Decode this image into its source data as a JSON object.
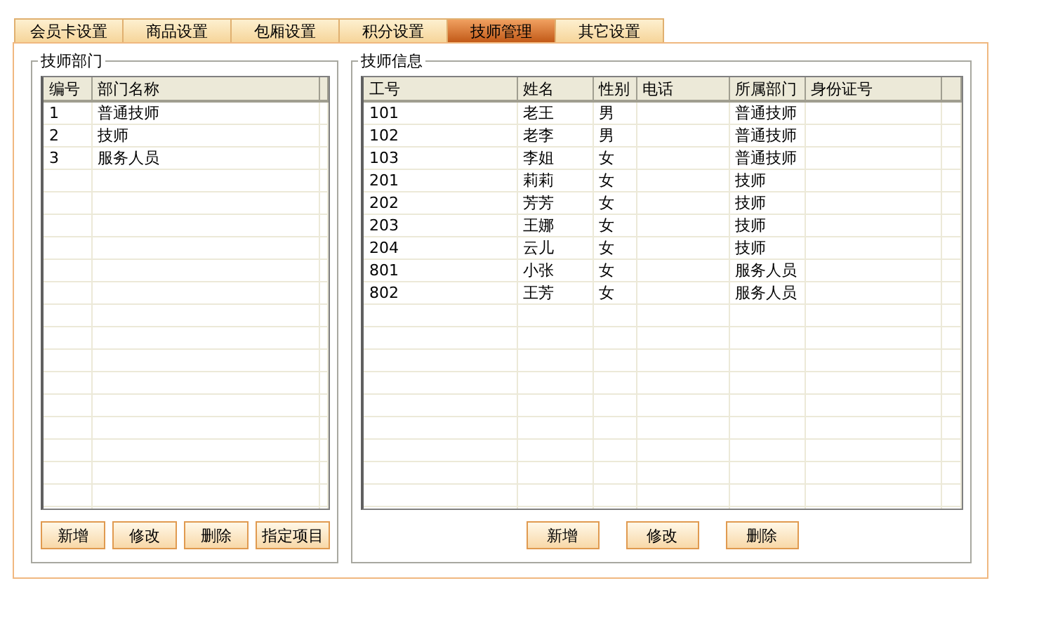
{
  "tabs": [
    {
      "label": "会员卡设置",
      "selected": false
    },
    {
      "label": "商品设置",
      "selected": false
    },
    {
      "label": "包厢设置",
      "selected": false
    },
    {
      "label": "积分设置",
      "selected": false
    },
    {
      "label": "技师管理",
      "selected": true
    },
    {
      "label": "其它设置",
      "selected": false
    }
  ],
  "departments": {
    "title": "技师部门",
    "columns": [
      "编号",
      "部门名称"
    ],
    "rows": [
      [
        "1",
        "普通技师"
      ],
      [
        "2",
        "技师"
      ],
      [
        "3",
        "服务人员"
      ]
    ],
    "buttons": [
      "新增",
      "修改",
      "删除",
      "指定项目"
    ]
  },
  "technicians": {
    "title": "技师信息",
    "columns": [
      "工号",
      "姓名",
      "性别",
      "电话",
      "所属部门",
      "身份证号"
    ],
    "rows": [
      [
        "101",
        "老王",
        "男",
        "",
        "普通技师",
        ""
      ],
      [
        "102",
        "老李",
        "男",
        "",
        "普通技师",
        ""
      ],
      [
        "103",
        "李姐",
        "女",
        "",
        "普通技师",
        ""
      ],
      [
        "201",
        "莉莉",
        "女",
        "",
        "技师",
        ""
      ],
      [
        "202",
        "芳芳",
        "女",
        "",
        "技师",
        ""
      ],
      [
        "203",
        "王娜",
        "女",
        "",
        "技师",
        ""
      ],
      [
        "204",
        "云儿",
        "女",
        "",
        "技师",
        ""
      ],
      [
        "801",
        "小张",
        "女",
        "",
        "服务人员",
        ""
      ],
      [
        "802",
        "王芳",
        "女",
        "",
        "服务人员",
        ""
      ]
    ],
    "buttons": [
      "新增",
      "修改",
      "删除"
    ]
  }
}
